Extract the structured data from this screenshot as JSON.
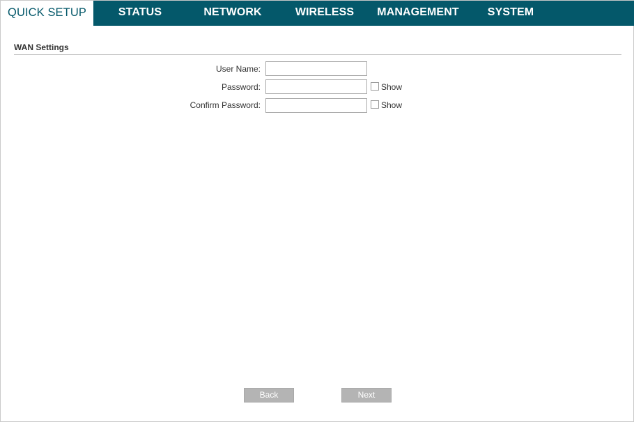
{
  "nav": {
    "tabs": [
      {
        "label": "QUICK SETUP",
        "active": true
      },
      {
        "label": "STATUS"
      },
      {
        "label": "NETWORK"
      },
      {
        "label": "WIRELESS"
      },
      {
        "label": "MANAGEMENT"
      },
      {
        "label": "SYSTEM"
      }
    ]
  },
  "section": {
    "title": "WAN Settings"
  },
  "form": {
    "username": {
      "label": "User Name:",
      "value": ""
    },
    "password": {
      "label": "Password:",
      "value": "",
      "show_label": "Show"
    },
    "confirm": {
      "label": "Confirm Password:",
      "value": "",
      "show_label": "Show"
    }
  },
  "buttons": {
    "back": "Back",
    "next": "Next"
  },
  "colors": {
    "nav_bg": "#04586a",
    "button_bg": "#b4b4b4"
  }
}
